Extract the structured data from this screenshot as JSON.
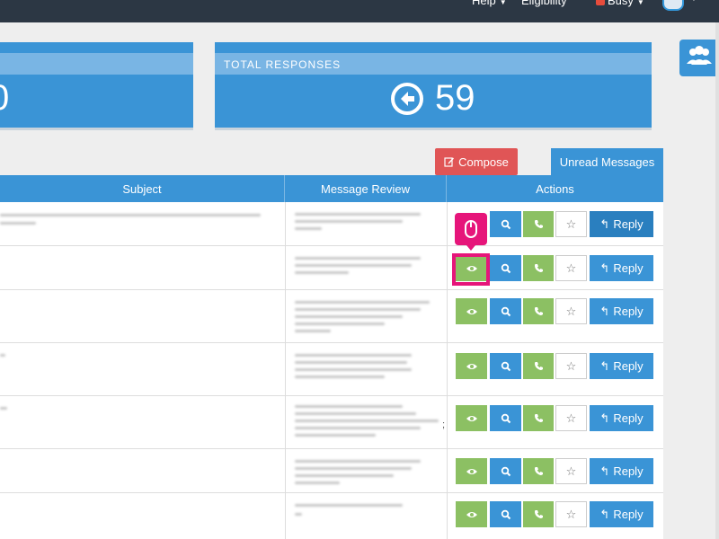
{
  "topbar": {
    "menus": [
      {
        "label": "Help"
      },
      {
        "label": "Eligibility"
      },
      {
        "label": "Busy"
      }
    ],
    "busy_color": "#e74c3c"
  },
  "stats": {
    "left_partial_value": "0",
    "total_responses_label": "TOTAL RESPONSES",
    "total_responses_value": "59",
    "icon": "arrow-circle-left-icon"
  },
  "toolbar": {
    "compose_label": "Compose",
    "compose_icon": "edit-icon",
    "unread_label": "Unread Messages"
  },
  "table": {
    "headers": [
      "Subject",
      "Message Review",
      "Actions"
    ],
    "reply_label": "Reply",
    "row_count": 7,
    "row_6_fragment": ";"
  },
  "tooltip": {
    "icon": "mouse-icon"
  },
  "colors": {
    "primary": "#3a94d6",
    "success": "#8cc063",
    "danger": "#e05556",
    "highlight": "#e6157a",
    "topbar": "#2c3744"
  }
}
